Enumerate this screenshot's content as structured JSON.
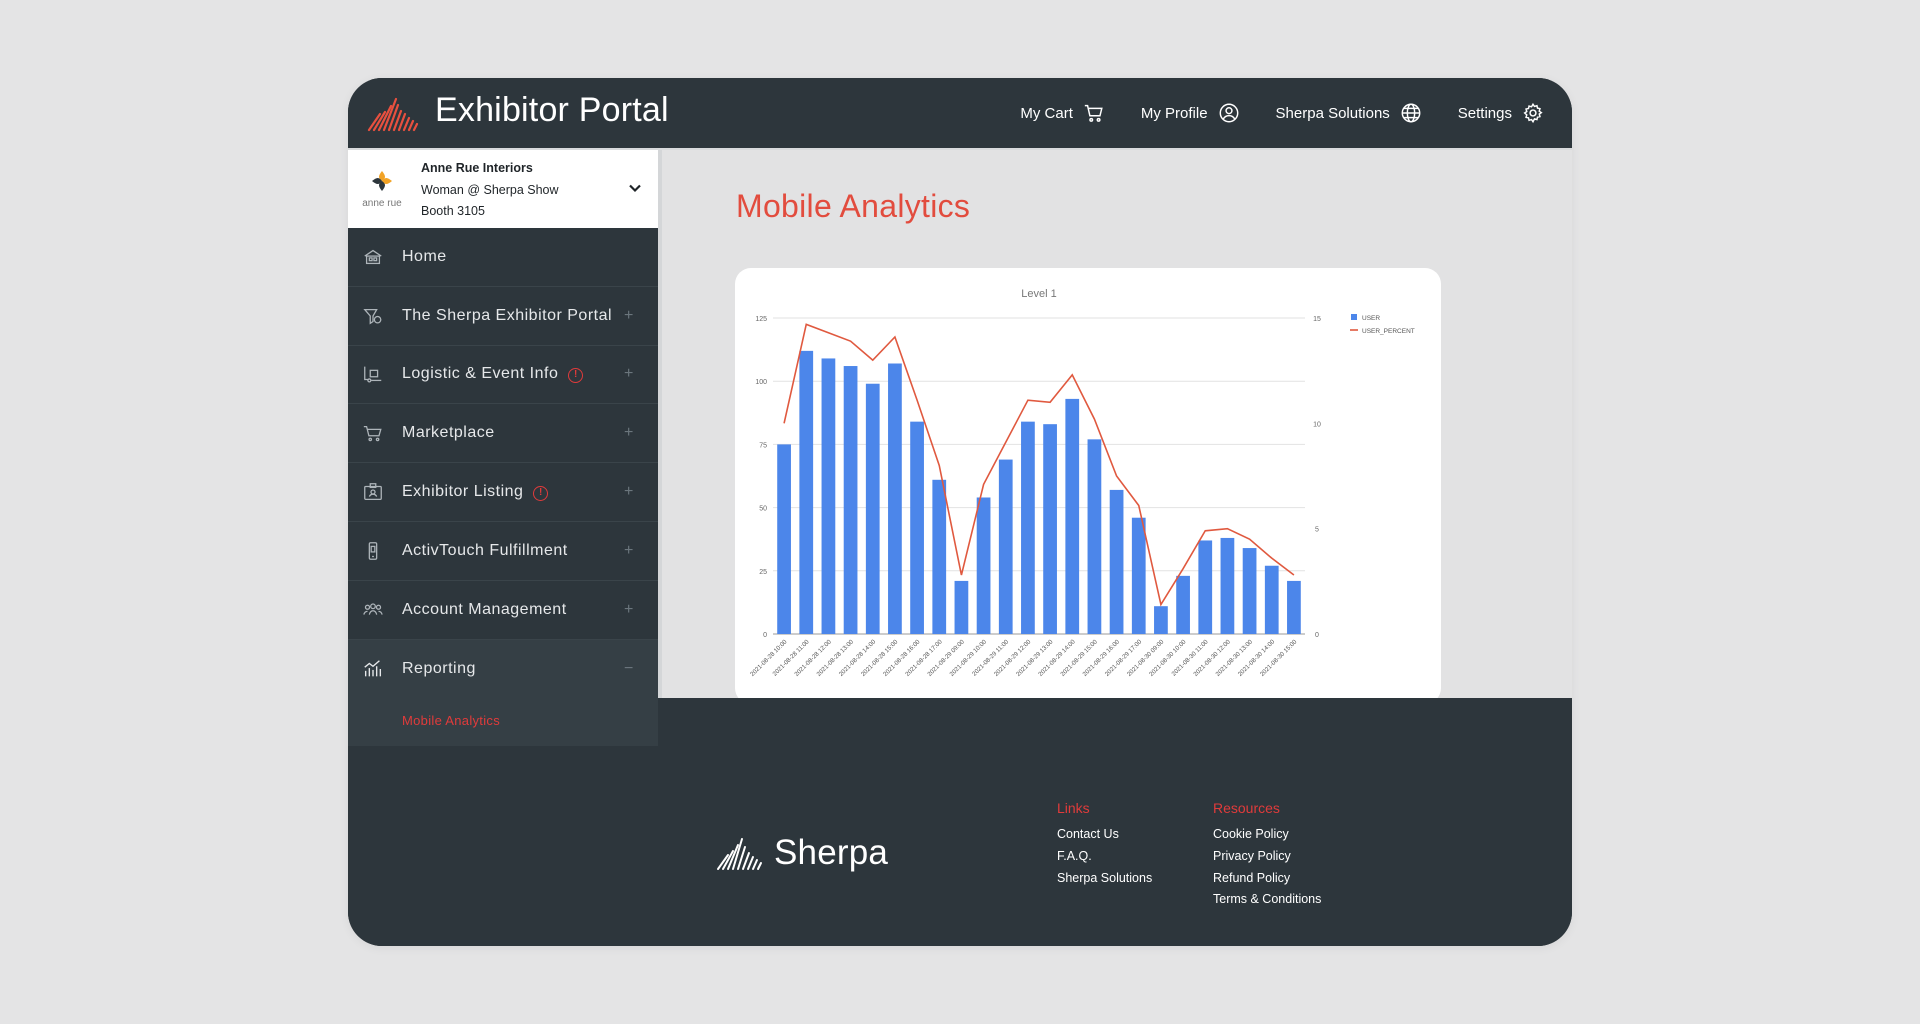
{
  "header": {
    "title": "Exhibitor Portal",
    "nav": [
      {
        "label": "My Cart",
        "icon": "cart-icon"
      },
      {
        "label": "My Profile",
        "icon": "user-circle-icon"
      },
      {
        "label": "Sherpa Solutions",
        "icon": "globe-icon"
      },
      {
        "label": "Settings",
        "icon": "gear-icon"
      }
    ]
  },
  "account": {
    "name": "Anne Rue Interiors",
    "role": "Woman @ Sherpa Show",
    "booth": "Booth 3105",
    "logo_text": "anne rue"
  },
  "sidebar": {
    "items": [
      {
        "label": "Home",
        "icon": "home-icon",
        "expandable": false,
        "alert": false
      },
      {
        "label": "The Sherpa Exhibitor Portal",
        "icon": "portal-icon",
        "expandable": true,
        "alert": false
      },
      {
        "label": "Logistic & Event Info",
        "icon": "logistics-icon",
        "expandable": true,
        "alert": true
      },
      {
        "label": "Marketplace",
        "icon": "cart-icon",
        "expandable": true,
        "alert": false
      },
      {
        "label": "Exhibitor Listing",
        "icon": "listing-icon",
        "expandable": true,
        "alert": true
      },
      {
        "label": "ActivTouch Fulfillment",
        "icon": "device-icon",
        "expandable": true,
        "alert": false
      },
      {
        "label": "Account Management",
        "icon": "users-icon",
        "expandable": true,
        "alert": false
      },
      {
        "label": "Reporting",
        "icon": "reporting-icon",
        "expandable": true,
        "alert": false,
        "expanded": true
      }
    ],
    "plus": "+",
    "minus": "−",
    "alert_glyph": "!",
    "reporting_sub": [
      {
        "label": "Mobile Analytics",
        "active": true
      }
    ]
  },
  "main": {
    "title": "Mobile Analytics"
  },
  "chart_data": {
    "type": "bar",
    "title": "Level 1",
    "categories": [
      "2021-08-28 10:00",
      "2021-08-28 11:00",
      "2021-08-28 12:00",
      "2021-08-28 13:00",
      "2021-08-28 14:00",
      "2021-08-28 15:00",
      "2021-08-28 16:00",
      "2021-08-28 17:00",
      "2021-08-29 09:00",
      "2021-08-29 10:00",
      "2021-08-29 11:00",
      "2021-08-29 12:00",
      "2021-08-29 13:00",
      "2021-08-29 14:00",
      "2021-08-29 15:00",
      "2021-08-29 16:00",
      "2021-08-29 17:00",
      "2021-08-30 09:00",
      "2021-08-30 10:00",
      "2021-08-30 11:00",
      "2021-08-30 12:00",
      "2021-08-30 13:00",
      "2021-08-30 14:00",
      "2021-08-30 15:00"
    ],
    "series": [
      {
        "name": "USER",
        "kind": "bar",
        "axis": "left",
        "color": "#4c86ea",
        "values": [
          75,
          112,
          109,
          106,
          99,
          107,
          84,
          61,
          21,
          54,
          69,
          84,
          83,
          93,
          77,
          57,
          46,
          11,
          23,
          37,
          38,
          34,
          27,
          21
        ]
      },
      {
        "name": "USER_PERCENT",
        "kind": "line",
        "axis": "right",
        "color": "#e0593f",
        "values": [
          10.0,
          14.7,
          14.3,
          13.9,
          13.0,
          14.1,
          11.1,
          8.0,
          2.8,
          7.1,
          9.1,
          11.1,
          11.0,
          12.3,
          10.2,
          7.5,
          6.1,
          1.4,
          3.1,
          4.9,
          5.0,
          4.5,
          3.6,
          2.8
        ]
      }
    ],
    "yleft": {
      "ylim": [
        0,
        125
      ],
      "ticks": [
        0,
        25,
        50,
        75,
        100,
        125
      ]
    },
    "yright": {
      "ylim": [
        0,
        15
      ],
      "ticks": [
        0,
        5,
        10,
        15
      ]
    },
    "grid": true,
    "legend": "top-right"
  },
  "footer": {
    "brand": "Sherpa",
    "links_heading": "Links",
    "links": [
      "Contact Us",
      "F.A.Q.",
      "Sherpa Solutions"
    ],
    "resources_heading": "Resources",
    "resources": [
      "Cookie Policy",
      "Privacy Policy",
      "Refund Policy",
      "Terms & Conditions"
    ]
  },
  "colors": {
    "dark": "#2d363c",
    "accent": "#e24c3e",
    "bar": "#4c86ea"
  }
}
